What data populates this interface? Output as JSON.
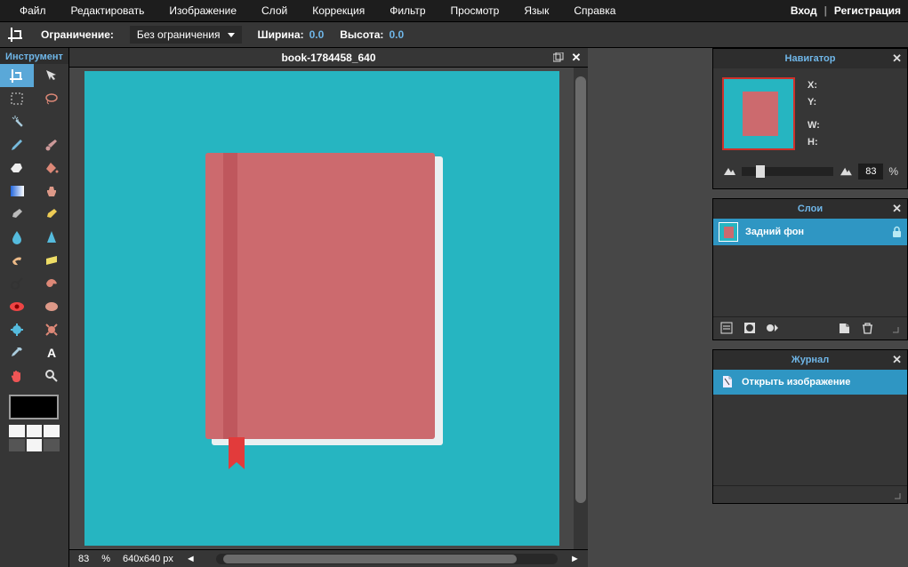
{
  "menubar": {
    "items": [
      "Файл",
      "Редактировать",
      "Изображение",
      "Слой",
      "Коррекция",
      "Фильтр",
      "Просмотр",
      "Язык",
      "Справка"
    ],
    "login": "Вход",
    "register": "Регистрация"
  },
  "options": {
    "constraint_label": "Ограничение:",
    "constraint_value": "Без ограничения",
    "width_label": "Ширина:",
    "width_value": "0.0",
    "height_label": "Высота:",
    "height_value": "0.0"
  },
  "tools": {
    "title": "Инструмент"
  },
  "document": {
    "title": "book-1784458_640",
    "zoom": "83",
    "zoom_pct": "%",
    "dimensions": "640x640 px"
  },
  "navigator": {
    "title": "Навигатор",
    "x": "X:",
    "y": "Y:",
    "w": "W:",
    "h": "H:",
    "zoom": "83",
    "pct": "%"
  },
  "layers": {
    "title": "Слои",
    "background": "Задний фон"
  },
  "history": {
    "title": "Журнал",
    "open": "Открыть изображение"
  }
}
